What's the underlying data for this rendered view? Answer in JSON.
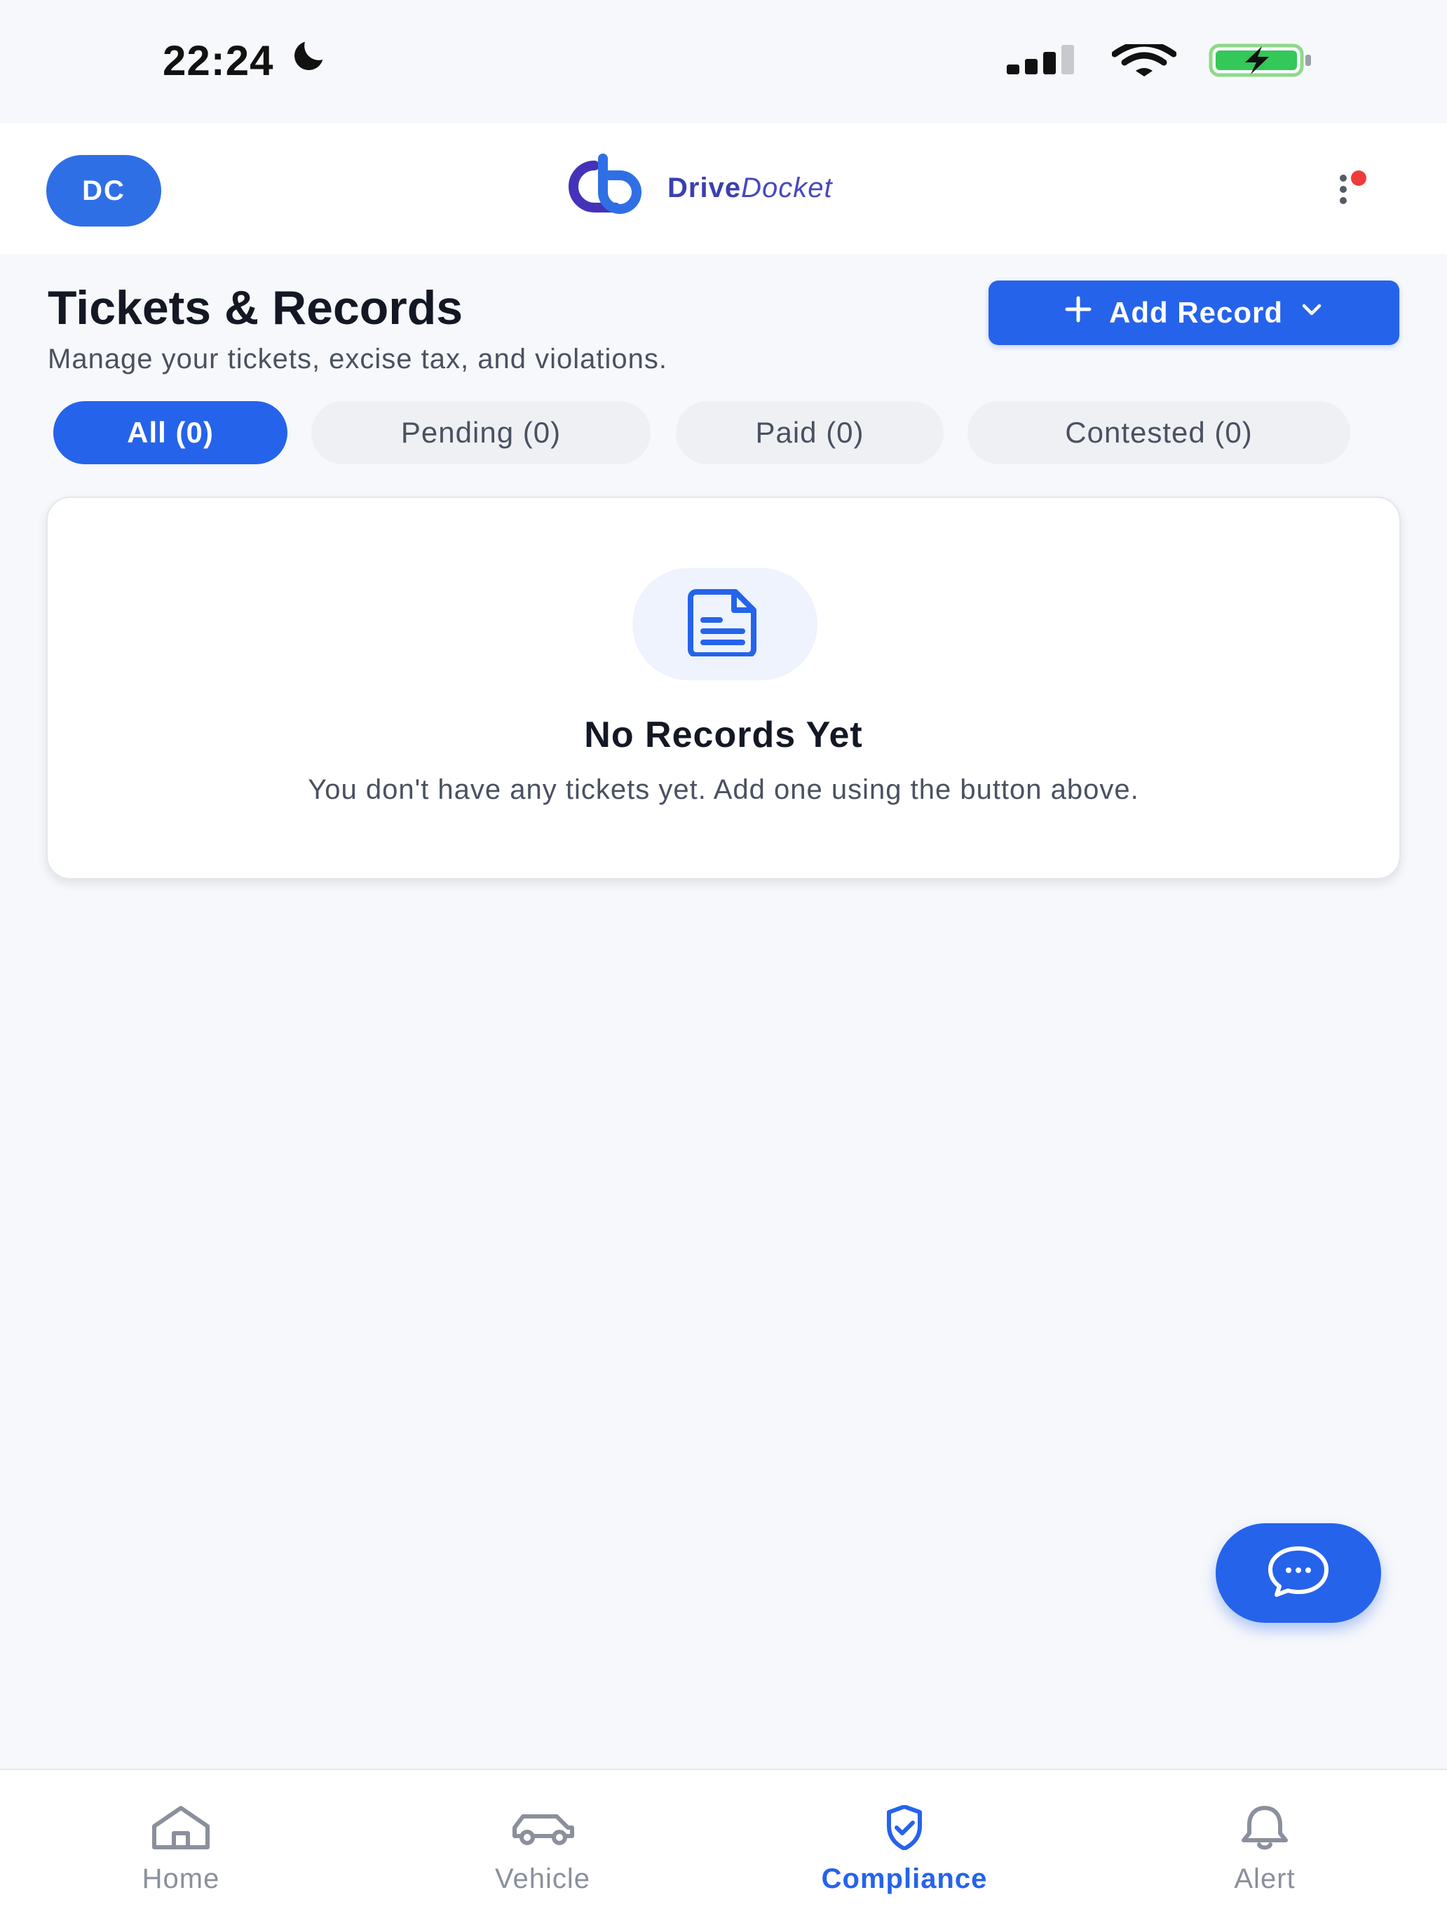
{
  "status_bar": {
    "time": "22:24",
    "icons": [
      "moon-icon",
      "cellular-signal-icon",
      "wifi-icon",
      "battery-charging-icon"
    ]
  },
  "header": {
    "avatar_initials": "DC",
    "logo": {
      "part1": "Drive",
      "part2": "Docket",
      "icon": "drivedocket-logo-icon"
    },
    "menu_icon": "more-vertical-icon",
    "notification_dot_color": "#ef3b3b"
  },
  "page": {
    "title": "Tickets & Records",
    "subtitle": "Manage your tickets, excise tax, and violations.",
    "add_button": {
      "label": "Add Record",
      "icon_left": "plus-icon",
      "icon_right": "chevron-down-icon"
    }
  },
  "tabs": [
    {
      "label": "All (0)",
      "active": true
    },
    {
      "label": "Pending (0)",
      "active": false
    },
    {
      "label": "Paid (0)",
      "active": false
    },
    {
      "label": "Contested (0)",
      "active": false
    }
  ],
  "empty_state": {
    "icon": "document-icon",
    "title": "No Records Yet",
    "message": "You don't have any tickets yet. Add one using the button above."
  },
  "chat_fab": {
    "icon": "chat-bubble-icon"
  },
  "bottom_nav": [
    {
      "label": "Home",
      "icon": "home-icon",
      "active": false
    },
    {
      "label": "Vehicle",
      "icon": "car-icon",
      "active": false
    },
    {
      "label": "Compliance",
      "icon": "shield-check-icon",
      "active": true
    },
    {
      "label": "Alert",
      "icon": "bell-icon",
      "active": false
    }
  ],
  "colors": {
    "primary": "#2563eb",
    "background": "#f7f8fb",
    "text": "#141824",
    "muted": "#4a5160"
  }
}
